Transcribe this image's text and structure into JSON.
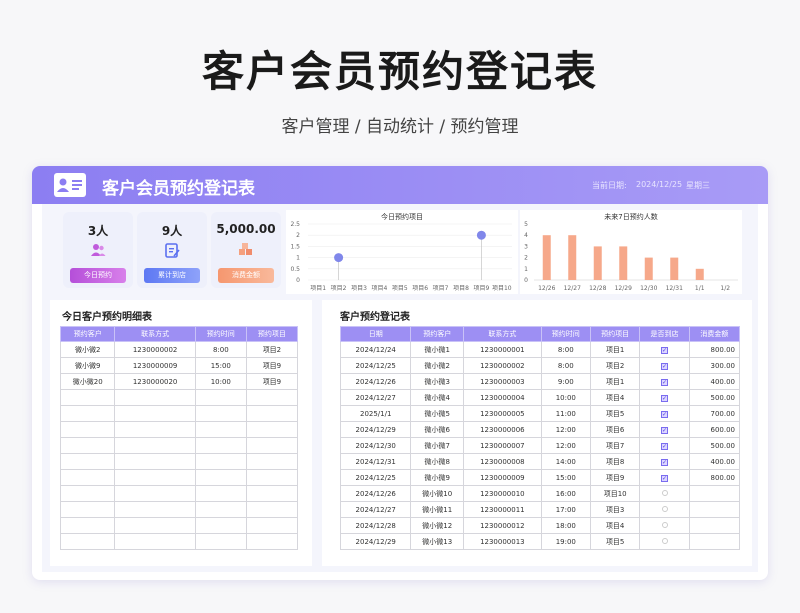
{
  "page": {
    "title": "客户会员预约登记表",
    "subtitle": "客户管理 / 自动统计 / 预约管理"
  },
  "header": {
    "title": "客户会员预约登记表",
    "date_label": "当前日期:",
    "date_value": "2024/12/25",
    "weekday": "星期三"
  },
  "stats": [
    {
      "value": "3人",
      "label": "今日预约",
      "icon": "users-icon",
      "color": "#c05bdc"
    },
    {
      "value": "9人",
      "label": "累计到店",
      "icon": "checklist-icon",
      "color": "#6a7ef5"
    },
    {
      "value": "5,000.00",
      "label": "消费金额",
      "icon": "cubes-icon",
      "color": "#f5a07e"
    }
  ],
  "chart_data": [
    {
      "type": "scatter",
      "title": "今日预约项目",
      "categories": [
        "项目1",
        "项目2",
        "项目3",
        "项目4",
        "项目5",
        "项目6",
        "项目7",
        "项目8",
        "项目9",
        "项目10"
      ],
      "values": [
        0,
        1,
        0,
        0,
        0,
        0,
        0,
        0,
        2,
        0
      ],
      "ylim": [
        0,
        2.5
      ],
      "yticks": [
        "2.5",
        "2",
        "1.5",
        "1",
        "0.5",
        "0"
      ]
    },
    {
      "type": "bar",
      "title": "未来7日预约人数",
      "categories": [
        "12/26",
        "12/27",
        "12/28",
        "12/29",
        "12/30",
        "12/31",
        "1/1",
        "1/2"
      ],
      "values": [
        4,
        4,
        3,
        3,
        2,
        2,
        1,
        0
      ],
      "ylim": [
        0,
        5
      ],
      "yticks": [
        "5",
        "4",
        "3",
        "2",
        "1",
        "0"
      ]
    }
  ],
  "left_panel": {
    "title": "今日客户预约明细表",
    "headers": [
      "预约客户",
      "联系方式",
      "预约时间",
      "预约项目"
    ],
    "rows": [
      [
        "微小微2",
        "1230000002",
        "8:00",
        "项目2"
      ],
      [
        "微小微9",
        "1230000009",
        "15:00",
        "项目9"
      ],
      [
        "微小微20",
        "1230000020",
        "10:00",
        "项目9"
      ]
    ]
  },
  "right_panel": {
    "title": "客户预约登记表",
    "headers": [
      "日期",
      "预约客户",
      "联系方式",
      "预约时间",
      "预约项目",
      "是否到店",
      "消费金额"
    ],
    "rows": [
      [
        "2024/12/24",
        "微小微1",
        "1230000001",
        "8:00",
        "项目1",
        true,
        "800.00"
      ],
      [
        "2024/12/25",
        "微小微2",
        "1230000002",
        "8:00",
        "项目2",
        true,
        "300.00"
      ],
      [
        "2024/12/26",
        "微小微3",
        "1230000003",
        "9:00",
        "项目1",
        true,
        "400.00"
      ],
      [
        "2024/12/27",
        "微小微4",
        "1230000004",
        "10:00",
        "项目4",
        true,
        "500.00"
      ],
      [
        "2025/1/1",
        "微小微5",
        "1230000005",
        "11:00",
        "项目5",
        true,
        "700.00"
      ],
      [
        "2024/12/29",
        "微小微6",
        "1230000006",
        "12:00",
        "项目6",
        true,
        "600.00"
      ],
      [
        "2024/12/30",
        "微小微7",
        "1230000007",
        "12:00",
        "项目7",
        true,
        "500.00"
      ],
      [
        "2024/12/31",
        "微小微8",
        "1230000008",
        "14:00",
        "项目8",
        true,
        "400.00"
      ],
      [
        "2024/12/25",
        "微小微9",
        "1230000009",
        "15:00",
        "项目9",
        true,
        "800.00"
      ],
      [
        "2024/12/26",
        "微小微10",
        "1230000010",
        "16:00",
        "项目10",
        false,
        ""
      ],
      [
        "2024/12/27",
        "微小微11",
        "1230000011",
        "17:00",
        "项目3",
        false,
        ""
      ],
      [
        "2024/12/28",
        "微小微12",
        "1230000012",
        "18:00",
        "项目4",
        false,
        ""
      ],
      [
        "2024/12/29",
        "微小微13",
        "1230000013",
        "19:00",
        "项目5",
        false,
        ""
      ]
    ]
  }
}
